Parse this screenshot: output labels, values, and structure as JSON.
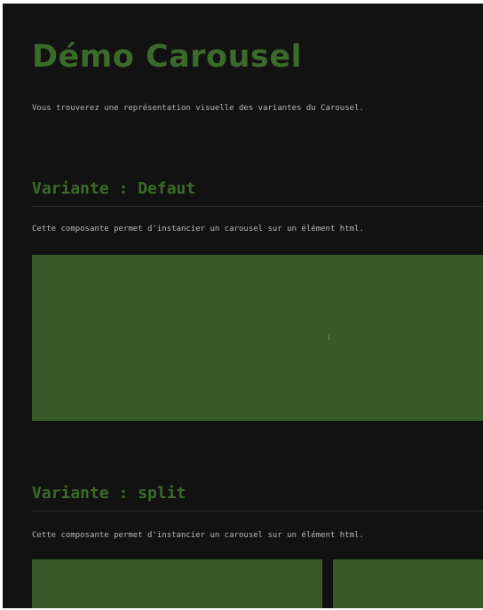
{
  "page": {
    "title": "Démo Carousel",
    "intro": "Vous trouverez une représentation visuelle des variantes du Carousel."
  },
  "sections": [
    {
      "title": "Variante : Defaut",
      "description": "Cette composante permet d'instancier un carousel sur un élément html.",
      "indicator": "⁝"
    },
    {
      "title": "Variante : split",
      "description": "Cette composante permet d'instancier un carousel sur un élément html."
    }
  ],
  "colors": {
    "background": "#121212",
    "accent": "#3a6b2a",
    "carousel": "#375a28",
    "text": "#b8b8b8"
  }
}
